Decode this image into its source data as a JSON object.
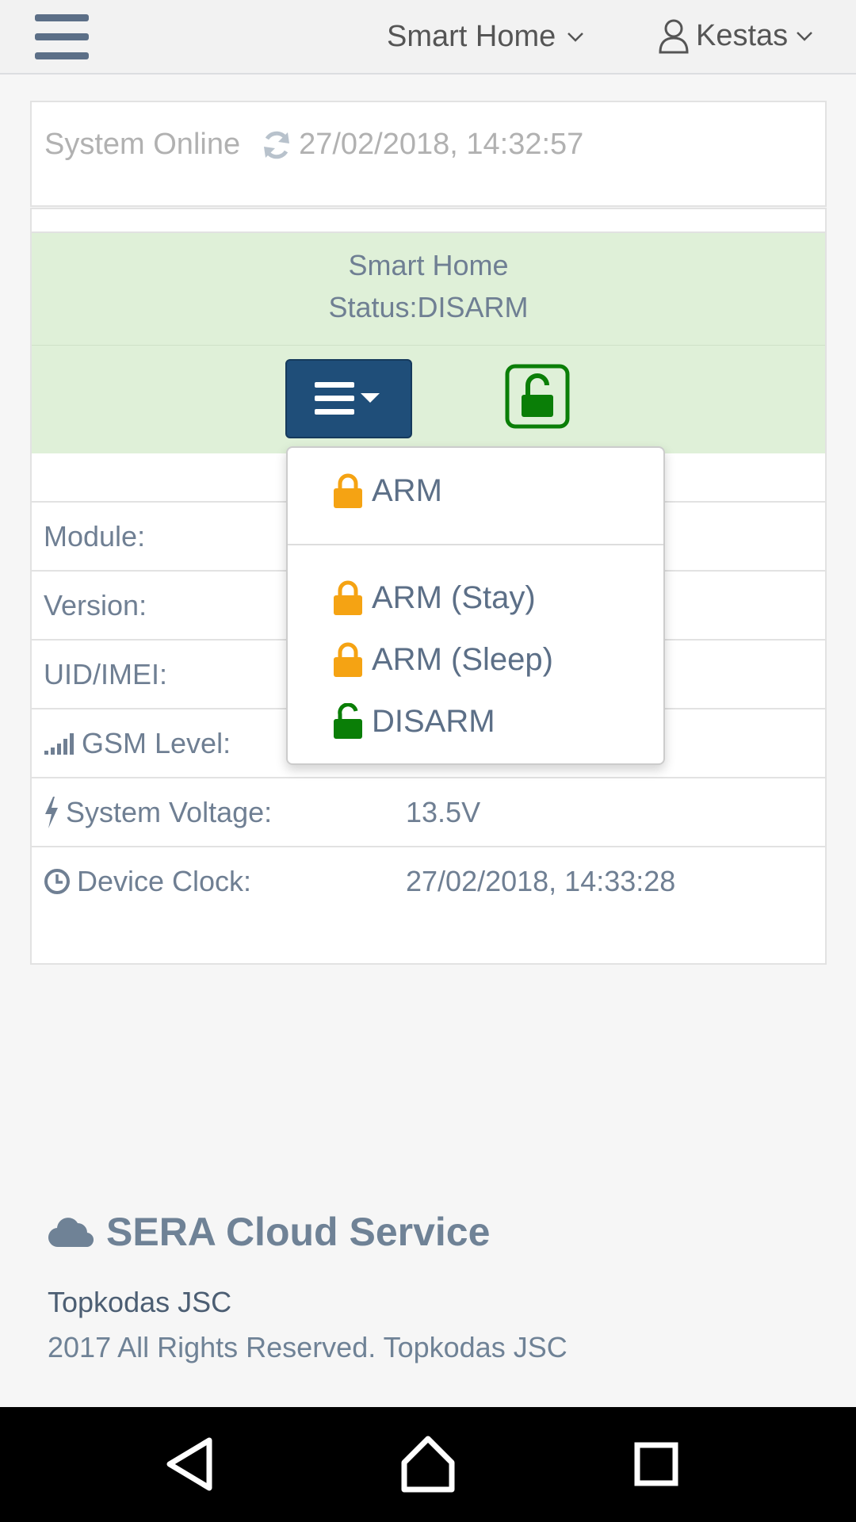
{
  "topbar": {
    "site_label": "Smart Home",
    "user_label": "Kestas"
  },
  "status": {
    "online_text": "System Online",
    "timestamp": "27/02/2018, 14:32:57"
  },
  "panel": {
    "header_title": "Smart Home",
    "header_status": "Status:DISARM",
    "rows": [
      {
        "label": "Module:",
        "value": ""
      },
      {
        "label": "Version:",
        "value": ""
      },
      {
        "label": "UID/IMEI:",
        "value": ""
      },
      {
        "label": "GSM Level:",
        "value": ""
      },
      {
        "label": "System Voltage:",
        "value": "13.5V"
      },
      {
        "label": "Device Clock:",
        "value": "27/02/2018, 14:33:28"
      }
    ]
  },
  "dropdown": {
    "items": [
      {
        "label": "ARM",
        "icon": "lock-icon",
        "color": "#f5a313"
      },
      {
        "label": "ARM (Stay)",
        "icon": "lock-icon",
        "color": "#f5a313"
      },
      {
        "label": "ARM (Sleep)",
        "icon": "lock-icon",
        "color": "#f5a313"
      },
      {
        "label": "DISARM",
        "icon": "unlock-icon",
        "color": "#0a7e07"
      }
    ]
  },
  "footer": {
    "brand": "SERA Cloud Service",
    "company": "Topkodas JSC",
    "rights": "2017 All Rights Reserved. Topkodas JSC"
  },
  "colors": {
    "accent_dark_blue": "#1f4e79",
    "status_green_bg": "#dff0d8",
    "lock_orange": "#f5a313",
    "unlock_green": "#0a7e07"
  }
}
